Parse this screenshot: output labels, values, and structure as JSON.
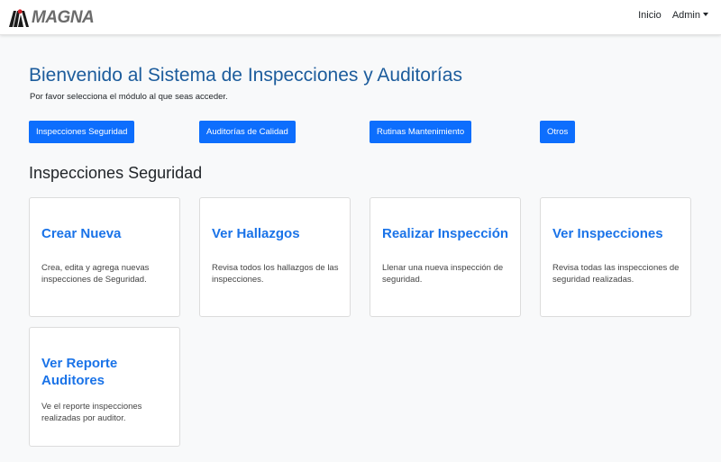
{
  "navbar": {
    "brand": "MAGNA",
    "links": [
      {
        "label": "Inicio"
      },
      {
        "label": "Admin"
      }
    ]
  },
  "header": {
    "title": "Bienvenido al Sistema de Inspecciones y Auditorías",
    "subtitle": "Por favor selecciona el módulo al que seas acceder."
  },
  "modules": [
    {
      "label": "Inspecciones Seguridad"
    },
    {
      "label": "Auditorías de Calidad"
    },
    {
      "label": "Rutinas Mantenimiento"
    },
    {
      "label": "Otros"
    }
  ],
  "section": {
    "title": "Inspecciones Seguridad",
    "cards": [
      {
        "title": "Crear Nueva",
        "text": "Crea, edita y agrega nuevas inspecciones de Seguridad."
      },
      {
        "title": "Ver Hallazgos",
        "text": "Revisa todos los hallazgos de las inspecciones."
      },
      {
        "title": "Realizar Inspección",
        "text": "Llenar una nueva inspección de seguridad."
      },
      {
        "title": "Ver Inspecciones",
        "text": "Revisa todas las inspecciones de seguridad realizadas."
      },
      {
        "title": "Ver Reporte Auditores",
        "text": "Ve el reporte inspecciones realizadas por auditor."
      }
    ]
  },
  "colors": {
    "primary_button": "#0d6efd",
    "page_title": "#1c5c9c",
    "card_title": "#1a73e8",
    "logo_red": "#d21f26",
    "logo_black": "#1a1a1a"
  }
}
